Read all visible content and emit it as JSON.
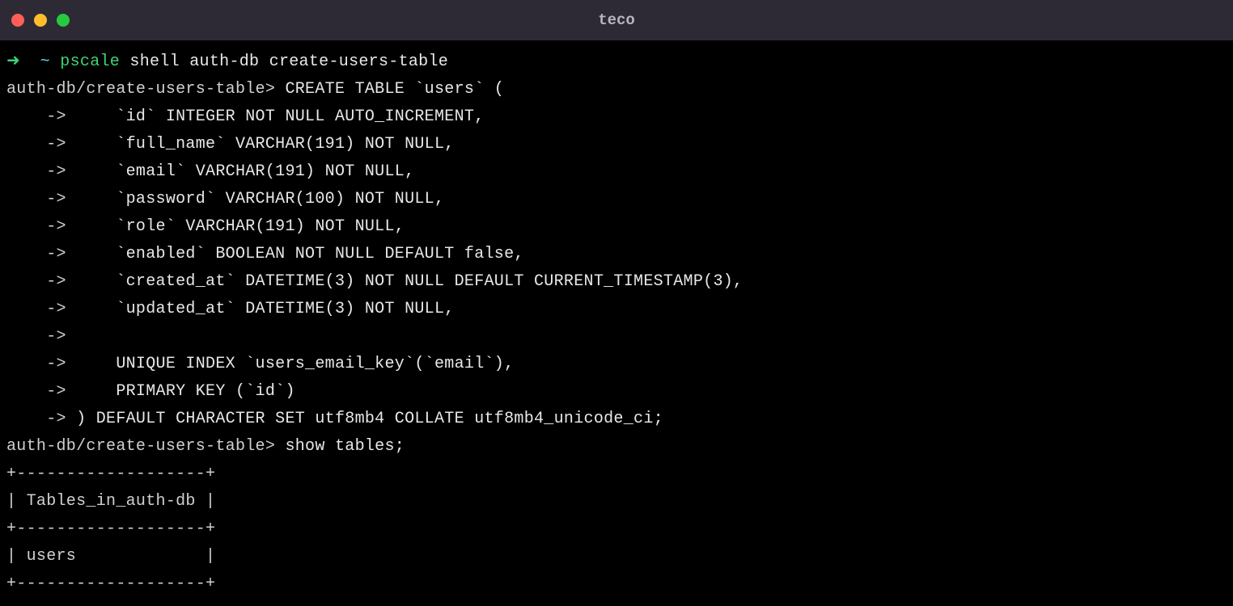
{
  "window": {
    "title": "teco"
  },
  "terminal": {
    "prompt1": {
      "arrow": "➜",
      "cwd": "~",
      "command_bin": "pscale",
      "command_args": "shell auth-db create-users-table"
    },
    "sql_prompt": "auth-db/create-users-table>",
    "continue_prompt": "    ->",
    "command2_text": " CREATE TABLE `users` (",
    "sql_lines": [
      "     `id` INTEGER NOT NULL AUTO_INCREMENT,",
      "     `full_name` VARCHAR(191) NOT NULL,",
      "     `email` VARCHAR(191) NOT NULL,",
      "     `password` VARCHAR(100) NOT NULL,",
      "     `role` VARCHAR(191) NOT NULL,",
      "     `enabled` BOOLEAN NOT NULL DEFAULT false,",
      "     `created_at` DATETIME(3) NOT NULL DEFAULT CURRENT_TIMESTAMP(3),",
      "     `updated_at` DATETIME(3) NOT NULL,",
      "",
      "     UNIQUE INDEX `users_email_key`(`email`),",
      "     PRIMARY KEY (`id`)",
      " ) DEFAULT CHARACTER SET utf8mb4 COLLATE utf8mb4_unicode_ci;"
    ],
    "command3_text": " show tables;",
    "table_output": [
      "+-------------------+",
      "| Tables_in_auth-db |",
      "+-------------------+",
      "| users             |",
      "+-------------------+"
    ]
  }
}
